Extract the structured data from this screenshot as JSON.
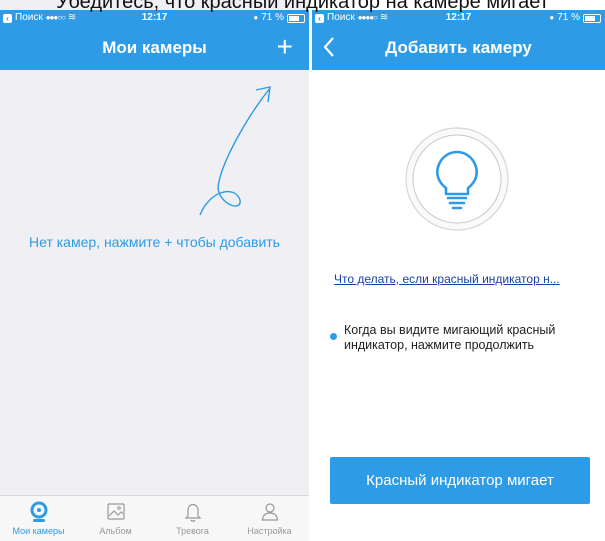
{
  "caption": "Убедитесь, что красный индикатор на камере мигает",
  "status_bar": {
    "back_label": "Поиск",
    "signal": "●●●○○",
    "signal_right": "●●●●○",
    "wifi": "≋",
    "time": "12:17",
    "battery": "71 %"
  },
  "left_screen": {
    "title": "Мои камеры",
    "add_icon": "plus-icon",
    "empty_message": "Нет камер, нажмите + чтобы добавить",
    "tabs": [
      {
        "label": "Мои камеры",
        "icon": "camera-icon",
        "active": true
      },
      {
        "label": "Альбом",
        "icon": "photo-icon",
        "active": false
      },
      {
        "label": "Тревога",
        "icon": "bell-icon",
        "active": false
      },
      {
        "label": "Настройка",
        "icon": "user-icon",
        "active": false
      }
    ]
  },
  "right_screen": {
    "title": "Добавить камеру",
    "back_icon": "chevron-left-icon",
    "illustration_icon": "lightbulb-icon",
    "help_link": "Что делать, если красный индикатор н...",
    "hint": "Когда вы видите мигающий красный индикатор, нажмите продолжить",
    "primary_button": "Красный индикатор мигает"
  },
  "colors": {
    "accent": "#2e9be6",
    "link": "#1a3faa",
    "background_left": "#f0eff4",
    "tab_inactive": "#999999"
  }
}
